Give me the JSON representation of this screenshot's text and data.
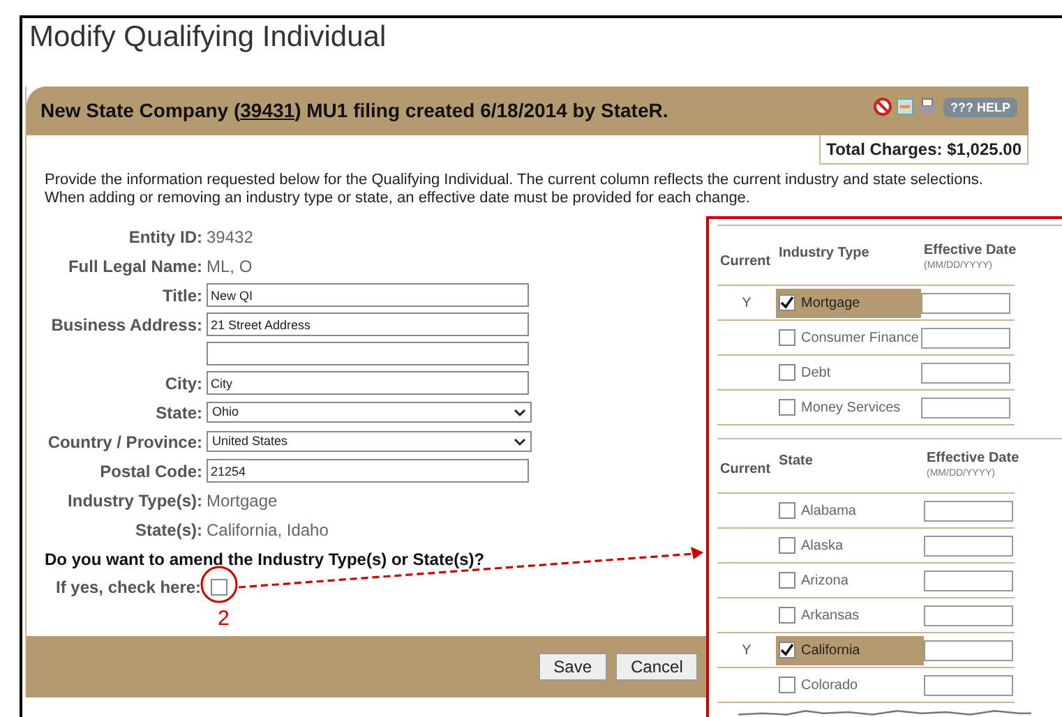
{
  "page_title": "Modify Qualifying Individual",
  "header": {
    "prefix": "New State Company (",
    "link": "39431",
    "suffix": ") MU1 filing created 6/18/2014 by StateR.",
    "help": "??? HELP"
  },
  "total_charges": "Total Charges: $1,025.00",
  "intro": "Provide the information requested below for the Qualifying Individual. The current column reflects the current industry and state selections. When adding or removing an industry type or state, an effective date must be provided for each change.",
  "fields": [
    {
      "kind": "static",
      "label": "Entity ID:",
      "value": "39432"
    },
    {
      "kind": "static",
      "label": "Full Legal Name:",
      "value": "ML, O"
    },
    {
      "kind": "text",
      "label": "Title:",
      "value": "New QI"
    },
    {
      "kind": "text",
      "label": "Business Address:",
      "value": "21 Street Address"
    },
    {
      "kind": "text"
    },
    {
      "kind": "text",
      "label": "City:",
      "value": "City"
    },
    {
      "kind": "select",
      "label": "State:",
      "value": "Ohio"
    },
    {
      "kind": "select",
      "label": "Country / Province:",
      "value": "United States"
    },
    {
      "kind": "text",
      "label": "Postal Code:",
      "value": "21254"
    },
    {
      "kind": "static",
      "label": "Industry Type(s):",
      "value": "Mortgage"
    },
    {
      "kind": "static",
      "label": "State(s):",
      "value": "California, Idaho"
    }
  ],
  "amend": {
    "question": "Do you want to amend the Industry Type(s) or State(s)?",
    "label": "If yes, check here:",
    "checked": false,
    "marker": "2"
  },
  "buttons": [
    "Save",
    "Cancel"
  ],
  "callout": {
    "industry": {
      "headers": [
        "Current",
        "Industry Type",
        "Effective Date"
      ],
      "date_hint": "(MM/DD/YYYY)",
      "rows": [
        {
          "current": "Y",
          "label": "Mortgage",
          "checked": true
        },
        {
          "label": "Consumer Finance",
          "checked": false
        },
        {
          "label": "Debt",
          "checked": false
        },
        {
          "label": "Money Services",
          "checked": false
        }
      ]
    },
    "states": {
      "headers": [
        "Current",
        "State",
        "Effective Date"
      ],
      "date_hint": "(MM/DD/YYYY)",
      "rows": [
        {
          "label": "Alabama",
          "checked": false
        },
        {
          "label": "Alaska",
          "checked": false
        },
        {
          "label": "Arizona",
          "checked": false
        },
        {
          "label": "Arkansas",
          "checked": false
        },
        {
          "current": "Y",
          "label": "California",
          "checked": true
        },
        {
          "label": "Colorado",
          "checked": false
        }
      ]
    }
  }
}
